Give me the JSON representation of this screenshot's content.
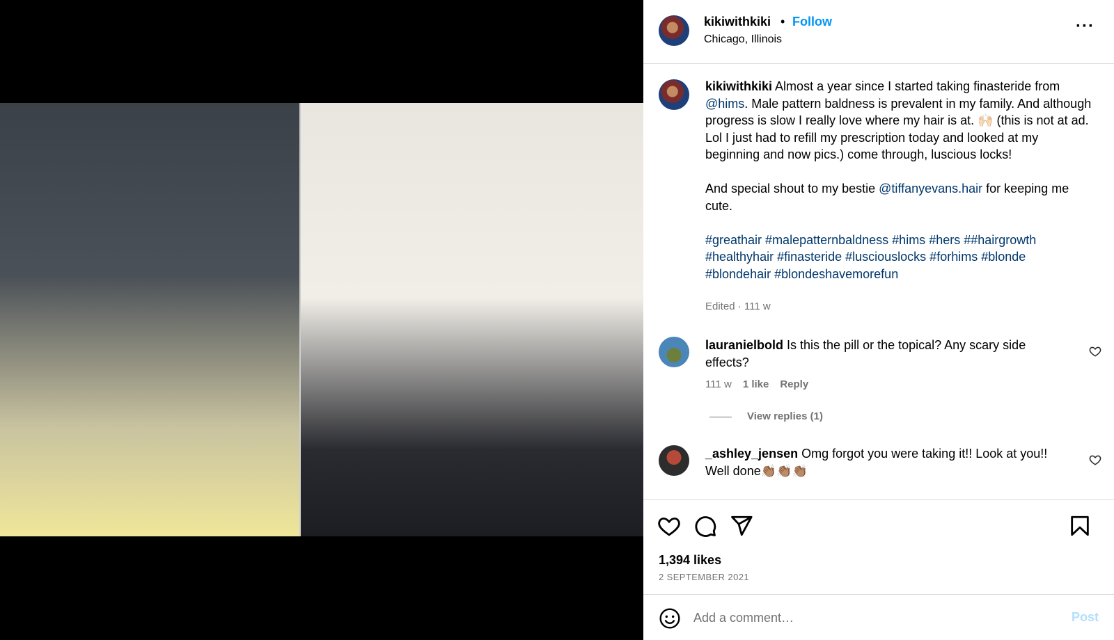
{
  "post": {
    "username": "kikiwithkiki",
    "follow_label": "Follow",
    "separator": "•",
    "location": "Chicago, Illinois",
    "more_icon": "more-options-icon"
  },
  "caption": {
    "username": "kikiwithkiki",
    "p1_a": " Almost a year since I started taking finasteride from ",
    "p1_mention": "@hims",
    "p1_b": ". Male pattern baldness is prevalent in my family. And although progress is slow I really love where my hair is at. 🙌🏻 (this is not at ad. Lol I just had to refill my prescription today and looked at my beginning and now pics.) come through, luscious locks!",
    "p2_a": "And special shout to my bestie ",
    "p2_mention": "@tiffanyevans.hair",
    "p2_b": " for keeping me cute.",
    "hashtags": "#greathair #malepatternbaldness #hims #hers ##hairgrowth #healthyhair #finasteride #lusciouslocks #forhims #blonde #blondehair #blondeshavemorefun",
    "meta": "Edited · 111 w"
  },
  "comments": [
    {
      "username": "lauranielbold",
      "text": " Is this the pill or the topical? Any scary side effects?",
      "time": "111 w",
      "likes": "1 like",
      "reply_label": "Reply",
      "view_replies": "View replies (1)"
    },
    {
      "username": "_ashley_jensen",
      "text": " Omg forgot you were taking it!! Look at you!! Well done👏🏽👏🏽👏🏽"
    }
  ],
  "actions": {
    "like_icon": "heart-icon",
    "comment_icon": "comment-icon",
    "share_icon": "share-icon",
    "save_icon": "bookmark-icon"
  },
  "likes": "1,394 likes",
  "date": "2 SEPTEMBER 2021",
  "add_comment": {
    "placeholder": "Add a comment…",
    "post_label": "Post",
    "emoji_icon": "emoji-icon"
  },
  "colors": {
    "link": "#00376b",
    "follow": "#0095f6",
    "post_disabled": "#b2dffc",
    "muted": "#737373",
    "border": "#dbdbdb"
  }
}
